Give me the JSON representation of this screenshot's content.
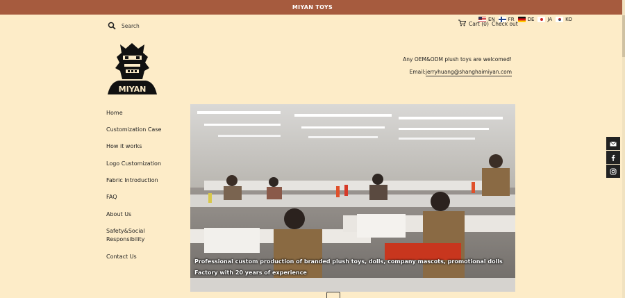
{
  "topbar": {
    "title": "MIYAN TOYS"
  },
  "search": {
    "label": "Search",
    "icon": "search-icon"
  },
  "cart": {
    "label": "Cart (0)",
    "checkout": "Check out",
    "icon": "cart-icon"
  },
  "languages": [
    {
      "code": "EN",
      "flag": "us"
    },
    {
      "code": "FR",
      "flag": "fr"
    },
    {
      "code": "DE",
      "flag": "de"
    },
    {
      "code": "JA",
      "flag": "ja"
    },
    {
      "code": "KO",
      "flag": "ko"
    }
  ],
  "logo": {
    "text": "MIYAN"
  },
  "header": {
    "welcome": "Any OEM&ODM plush toys are welcomed!",
    "email_label": "Email:",
    "email": "jerryhuang@shanghaimiyan.com"
  },
  "nav": {
    "items": [
      {
        "label": "Home"
      },
      {
        "label": "Customization Case"
      },
      {
        "label": "How it works"
      },
      {
        "label": "Logo Customization"
      },
      {
        "label": "Fabric Introduction"
      },
      {
        "label": "FAQ"
      },
      {
        "label": "About Us"
      },
      {
        "label": "Safety&Social Responsibility"
      },
      {
        "label": "Contact Us"
      }
    ]
  },
  "hero": {
    "caption_line1": "Professional custom production of branded plush toys, dolls, company mascots, promotional dolls",
    "caption_line2": "Factory with 20 years of experience"
  },
  "social": [
    "email-icon",
    "facebook-icon",
    "instagram-icon"
  ],
  "colors": {
    "topbar": "#a65b3e",
    "background": "#fdecc8",
    "social": "#222222"
  }
}
